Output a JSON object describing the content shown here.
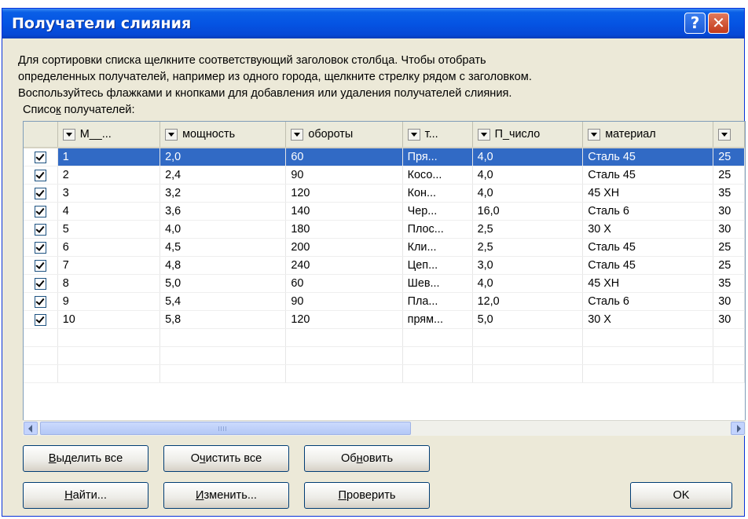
{
  "window": {
    "title": "Получатели слияния"
  },
  "instructions": "Для сортировки списка щелкните соответствующий заголовок столбца.  Чтобы отобрать\nопределенных получателей, например из одного города, щелкните стрелку рядом с заголовком.\nВоспользуйтесь флажками и кнопками для добавления или удаления получателей слияния.",
  "list_label": {
    "pre": "Списо",
    "hot": "к",
    "post": " получателей:"
  },
  "columns": [
    "М__...",
    "мощность",
    "обороты",
    "т...",
    "П_число",
    "материал"
  ],
  "rows": [
    {
      "checked": true,
      "cells": [
        "1",
        "2,0",
        "60",
        "Пря...",
        "4,0",
        "Сталь 45",
        "25"
      ]
    },
    {
      "checked": true,
      "cells": [
        "2",
        "2,4",
        "90",
        "Косо...",
        "4,0",
        "Сталь 45",
        "25"
      ]
    },
    {
      "checked": true,
      "cells": [
        "3",
        "3,2",
        "120",
        "Кон...",
        "4,0",
        "45 ХН",
        "35"
      ]
    },
    {
      "checked": true,
      "cells": [
        "4",
        "3,6",
        "140",
        "Чер...",
        "16,0",
        "Сталь 6",
        "30"
      ]
    },
    {
      "checked": true,
      "cells": [
        "5",
        "4,0",
        "180",
        "Плос...",
        "2,5",
        "30 Х",
        "30"
      ]
    },
    {
      "checked": true,
      "cells": [
        "6",
        "4,5",
        "200",
        "Кли...",
        "2,5",
        "Сталь 45",
        "25"
      ]
    },
    {
      "checked": true,
      "cells": [
        "7",
        "4,8",
        "240",
        "Цеп...",
        "3,0",
        "Сталь 45",
        "25"
      ]
    },
    {
      "checked": true,
      "cells": [
        "8",
        "5,0",
        "60",
        "Шев...",
        "4,0",
        "45 ХН",
        "35"
      ]
    },
    {
      "checked": true,
      "cells": [
        "9",
        "5,4",
        "90",
        "Пла...",
        "12,0",
        "Сталь 6",
        "30"
      ]
    },
    {
      "checked": true,
      "cells": [
        "10",
        "5,8",
        "120",
        "прям...",
        "5,0",
        "30 Х",
        "30"
      ]
    }
  ],
  "selected_row": 0,
  "buttons": {
    "select_all": {
      "pre": "",
      "hot": "В",
      "post": "ыделить все"
    },
    "clear_all": {
      "pre": "О",
      "hot": "ч",
      "post": "истить все"
    },
    "refresh": {
      "pre": "Об",
      "hot": "н",
      "post": "овить"
    },
    "find": {
      "pre": "",
      "hot": "Н",
      "post": "айти..."
    },
    "edit": {
      "pre": "",
      "hot": "И",
      "post": "зменить..."
    },
    "validate": {
      "pre": "",
      "hot": "П",
      "post": "роверить"
    },
    "ok": "OK"
  },
  "icons": {
    "help": "?",
    "close": "✕"
  },
  "colors": {
    "titlebar": "#0554e3",
    "selection": "#316ac5",
    "dialog_bg": "#ece9d8"
  }
}
